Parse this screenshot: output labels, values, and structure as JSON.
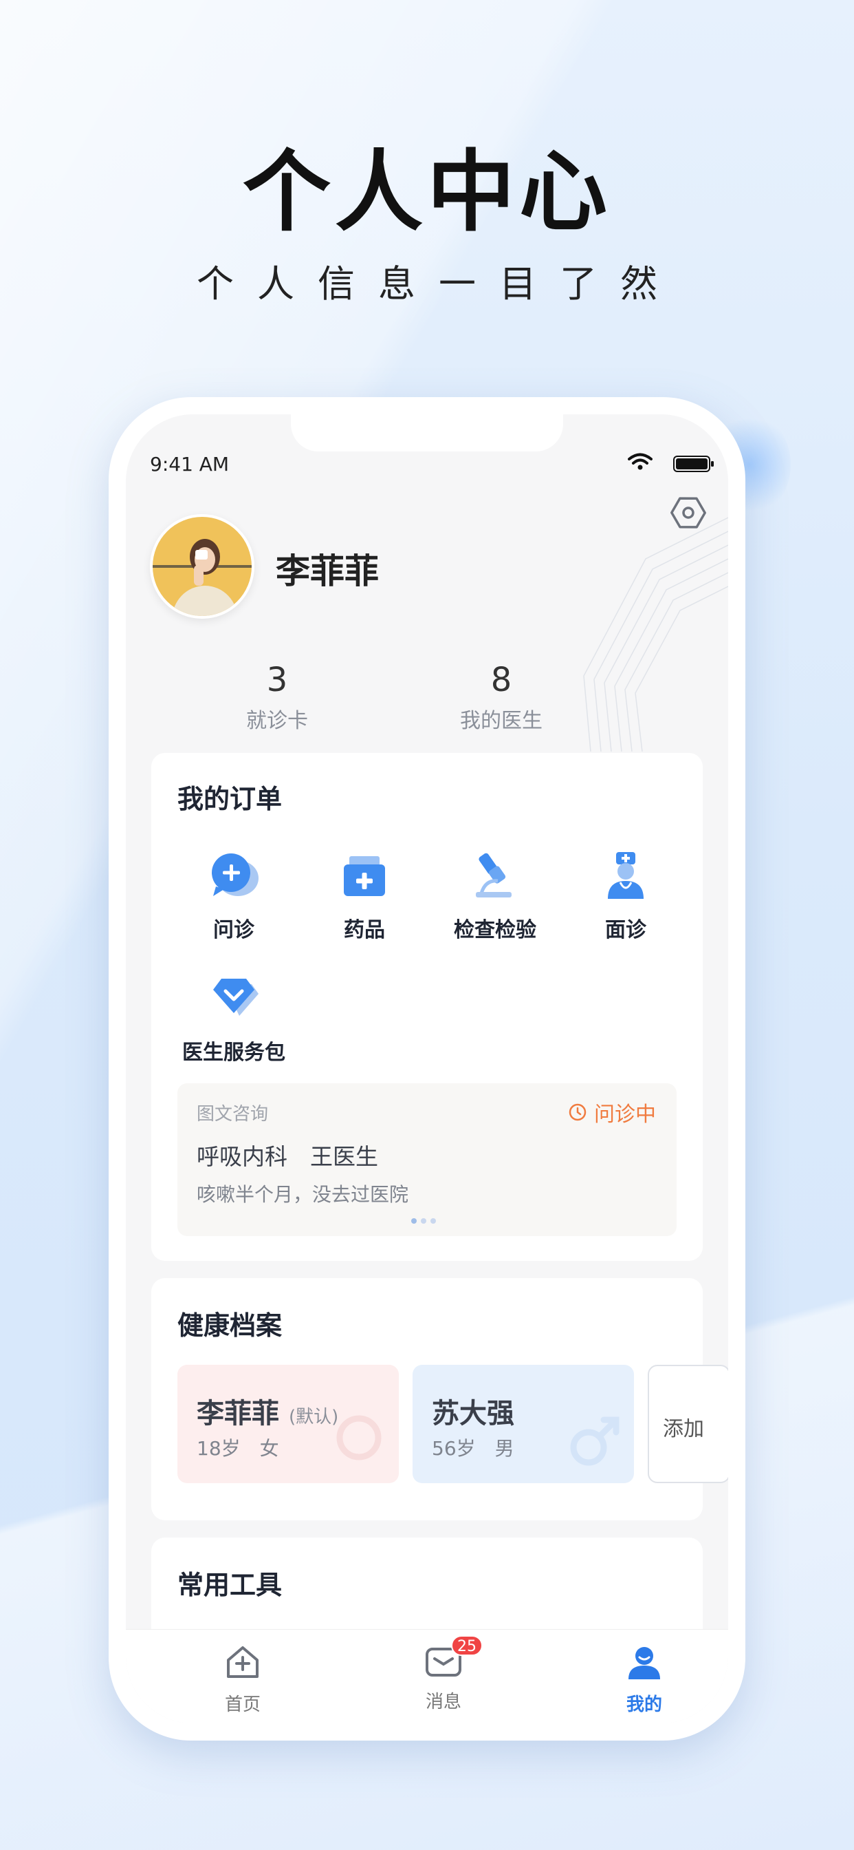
{
  "hero": {
    "title": "个人中心",
    "subtitle": "个人信息一目了然"
  },
  "status_bar": {
    "time": "9:41 AM"
  },
  "profile_header": {
    "user_name": "李菲菲",
    "stats": [
      {
        "value": "3",
        "label": "就诊卡"
      },
      {
        "value": "8",
        "label": "我的医生"
      }
    ]
  },
  "orders": {
    "title": "我的订单",
    "items": [
      {
        "label": "问诊",
        "icon": "consult-chat-icon"
      },
      {
        "label": "药品",
        "icon": "medicine-box-icon"
      },
      {
        "label": "检查检验",
        "icon": "microscope-icon"
      },
      {
        "label": "面诊",
        "icon": "nurse-icon"
      },
      {
        "label": "医生服务包",
        "icon": "service-package-icon"
      }
    ],
    "current_consult": {
      "type": "图文咨询",
      "status": "问诊中",
      "doctor": "呼吸内科　王医生",
      "description": "咳嗽半个月，没去过医院"
    }
  },
  "health_records": {
    "title": "健康档案",
    "profiles": [
      {
        "name": "李菲菲",
        "tag": "(默认)",
        "info": "18岁　女",
        "gender": "female"
      },
      {
        "name": "苏大强",
        "tag": "",
        "info": "56岁　男",
        "gender": "male"
      }
    ],
    "add_label": "添加"
  },
  "tools": {
    "title": "常用工具"
  },
  "tabbar": {
    "items": [
      {
        "label": "首页",
        "icon": "home-plus-icon"
      },
      {
        "label": "消息",
        "icon": "mail-icon",
        "badge": "25"
      },
      {
        "label": "我的",
        "icon": "user-icon",
        "active": true
      }
    ]
  },
  "colors": {
    "accent": "#2c7ae8",
    "status_orange": "#f07b3f",
    "badge_red": "#f04444",
    "female_card": "#fdeeee",
    "male_card": "#e6f0fc"
  }
}
